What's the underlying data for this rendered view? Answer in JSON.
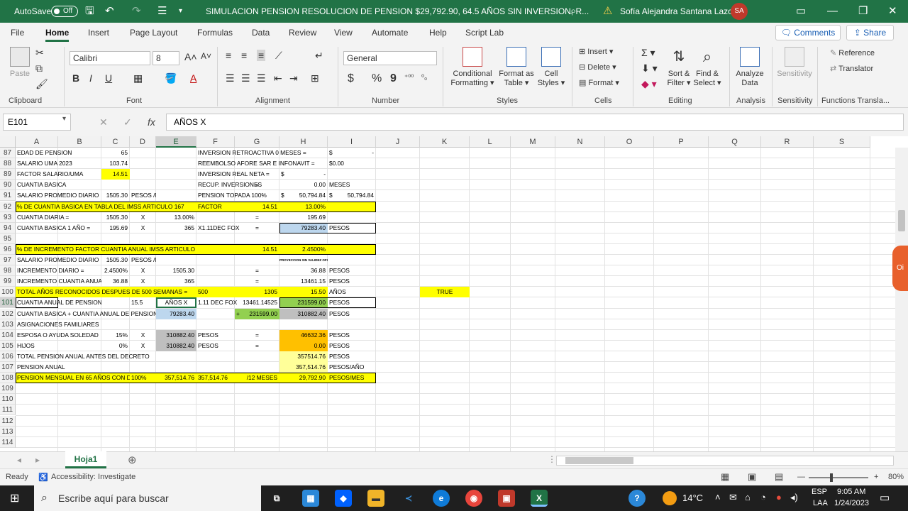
{
  "titlebar": {
    "autosave": "AutoSave",
    "toggle": "Off",
    "doc_title": "SIMULACION  PENSION RESOLUCION DE PENSION $29,792.90, 64.5 AÑOS SIN INVERSION, R...",
    "user": "Sofía Alejandra Santana Lazos",
    "initials": "SA"
  },
  "menu": {
    "tabs": [
      "File",
      "Home",
      "Insert",
      "Page Layout",
      "Formulas",
      "Data",
      "Review",
      "View",
      "Automate",
      "Help",
      "Script Lab"
    ],
    "comments": "Comments",
    "share": "Share"
  },
  "ribbon": {
    "clipboard": {
      "paste": "Paste",
      "label": "Clipboard"
    },
    "font": {
      "name": "Calibri",
      "size": "8",
      "bold": "B",
      "italic": "I",
      "underline": "U",
      "label": "Font"
    },
    "alignment": {
      "label": "Alignment"
    },
    "number": {
      "format": "General",
      "currency": "$",
      "percent": "%",
      "comma": "9",
      "label": "Number"
    },
    "styles": {
      "conditional": "Conditional",
      "conditional2": "Formatting",
      "format_table": "Format as",
      "format_table2": "Table",
      "cell_styles": "Cell",
      "cell_styles2": "Styles",
      "label": "Styles"
    },
    "cells": {
      "insert": "Insert",
      "delete": "Delete",
      "format": "Format",
      "label": "Cells"
    },
    "editing": {
      "sort": "Sort &",
      "sort2": "Filter",
      "find": "Find &",
      "find2": "Select",
      "label": "Editing"
    },
    "analysis": {
      "analyze": "Analyze",
      "analyze2": "Data",
      "label": "Analysis"
    },
    "sensitivity": {
      "name": "Sensitivity",
      "label": "Sensitivity"
    },
    "functions": {
      "reference": "Reference",
      "translator": "Translator",
      "label": "Functions Transla..."
    }
  },
  "formula_bar": {
    "name_box": "E101",
    "formula": "AÑOS    X"
  },
  "grid": {
    "columns": [
      "A",
      "B",
      "C",
      "D",
      "E",
      "F",
      "G",
      "H",
      "I",
      "J",
      "K",
      "L",
      "M",
      "N",
      "O",
      "P",
      "Q",
      "R",
      "S"
    ],
    "rows": [
      "87",
      "88",
      "89",
      "90",
      "91",
      "92",
      "93",
      "94",
      "95",
      "96",
      "97",
      "98",
      "99",
      "100",
      "101",
      "102",
      "103",
      "104",
      "105",
      "106",
      "107",
      "108",
      "109",
      "110",
      "111",
      "112",
      "113",
      "114"
    ],
    "cells": {
      "A87": "EDAD DE PENSION",
      "C87": "65",
      "F87": "INVERSION RETROACTIVA 0 MESES =",
      "I87a": "$",
      "I87b": "-",
      "A88": "SALARIO UMA 2023",
      "C88": "103.74",
      "F88": "REEMBOLSO AFORE SAR E INFONAVIT =",
      "I88": "$0.00",
      "A89": "FACTOR SALARIO/UMA",
      "C89": "14.51",
      "F89": "INVERSION REAL NETA =",
      "H89a": "$",
      "H89b": "-",
      "A90": "CUANTIA BASICA",
      "F90": "RECUP. INVERSIONES",
      "G90": "=",
      "H90": "0.00",
      "I90": "MESES",
      "A91": "SALARIO PROMEDIO DIARIO",
      "C91": "1505.30",
      "D91": "PESOS /MES",
      "F91": "PENSION TOPADA 100%",
      "H91a": "$",
      "H91b": "50,794.84",
      "I91a": "$",
      "I91b": "50,794.84",
      "A92": "% DE CUANTIA BASICA EN TABLA DEL IMSS ARTICULO 167",
      "F92": "FACTOR",
      "G92": "14.51",
      "H92": "13.00%",
      "A93": "CUANTIA DIARIA =",
      "C93": "1505.30",
      "D93": "X",
      "E93": "13.00%",
      "G93": "=",
      "H93": "195.69",
      "A94": "CUANTIA BASICA 1 AÑO =",
      "C94": "195.69",
      "D94": "X",
      "E94": "365",
      "F94": "X1.11DEC FOX",
      "G94": "=",
      "H94": "79283.40",
      "I94": "PESOS",
      "A96": "% DE INCREMENTO FACTOR CUANTIA ANUAL  IMSS ARTICULO 167 FACTOR",
      "G96": "14.51",
      "H96": "2.4500%",
      "A97": "SALARIO PROMEDIO DIARIO",
      "C97": "1505.30",
      "D97": "PESOS /MES",
      "H97": "PROYECCION SIN VALIDEZ OFICIAL",
      "A98": "INCREMENTO DIARIO =",
      "C98": "2.4500%",
      "D98": "X",
      "E98": "1505.30",
      "G98": "=",
      "H98": "36.88",
      "I98": "PESOS",
      "A99": "INCREMENTO CUANTIA ANUAL",
      "C99": "36.88",
      "D99": "X",
      "E99": "365",
      "G99": "=",
      "H99": "13461.15",
      "I99": "PESOS",
      "A100": "TOTAL AÑOS RECONOCIDOS DESPUES DE 500 SEMANAS =",
      "F100": "500",
      "G100": "1305",
      "H100": "15.50",
      "I100": "AÑOS",
      "K100": "TRUE",
      "A101": "CUANTIA ANUAL DE PENSION =",
      "D101": "15.5",
      "E101": "AÑOS    X",
      "F101": "1.11 DEC FOX",
      "G101": "13461.14525",
      "H101": "231599.00",
      "I101": "PESOS",
      "A102": "CUANTIA BASICA + CUANTIA ANUAL DE PENSION",
      "E102": "79283.40",
      "F102": "+",
      "G102": "231599.00",
      "H102": "310882.40",
      "I102": "PESOS",
      "A103": "ASIGNACIONES FAMILIARES",
      "A104": "ESPOSA O AYUDA SOLEDAD",
      "C104": "15%",
      "D104": "X",
      "E104": "310882.40",
      "F104": "PESOS",
      "G104": "=",
      "H104": "46632.36",
      "I104": "PESOS",
      "A105": "HIJOS",
      "C105": "0%",
      "D105": "X",
      "E105": "310882.40",
      "F105": "PESOS",
      "G105": "=",
      "H105": "0.00",
      "I105": "PESOS",
      "A106": "TOTAL PENSION ANUAL ANTES DEL DECRETO",
      "H106": "357514.76",
      "I106": "PESOS",
      "A107": "PENSION ANUAL",
      "H107": "357,514.76",
      "I107": "PESOS/AÑO",
      "A108": "PENSION MENSUAL EN 65 AÑOS CON DECRETO",
      "D108": "100%",
      "E108": "357,514.76",
      "F108": "357,514.76",
      "G108": "/12 MESES",
      "H108": "29,792.90",
      "I108": "PESOS/MES"
    }
  },
  "sheet": {
    "tab": "Hoja1"
  },
  "status": {
    "ready": "Ready",
    "accessibility": "Accessibility: Investigate",
    "zoom": "80%"
  },
  "taskbar": {
    "search": "Escribe aquí para buscar",
    "weather": "14°C",
    "lang1": "ESP",
    "lang2": "LAA",
    "time": "9:05 AM",
    "date": "1/24/2023"
  },
  "colors": {
    "excel_green": "#217346",
    "yellow": "#ffff00",
    "light_blue": "#bdd7ee",
    "green_fill": "#92d050",
    "gray_fill": "#bfbfbf",
    "orange_fill": "#ffc000"
  }
}
